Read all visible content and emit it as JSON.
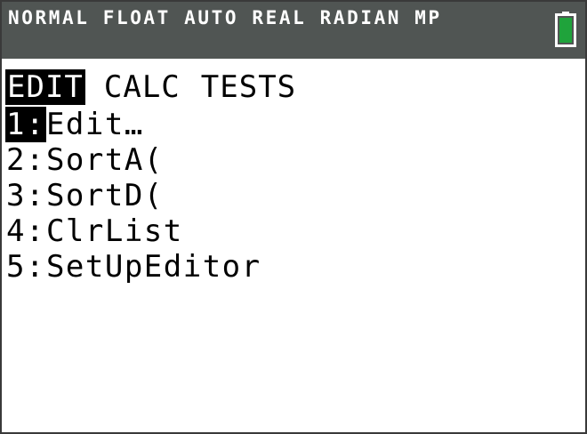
{
  "status_bar": {
    "text": "NORMAL FLOAT AUTO REAL RADIAN MP",
    "battery_icon": "battery-full-icon",
    "battery_color": "#1fa33b"
  },
  "tabs": [
    {
      "label": "EDIT",
      "active": true
    },
    {
      "label": "CALC",
      "active": false
    },
    {
      "label": "TESTS",
      "active": false
    }
  ],
  "menu": {
    "items": [
      {
        "number": "1:",
        "label": "Edit…",
        "selected": true
      },
      {
        "number": "2:",
        "label": "SortA(",
        "selected": false
      },
      {
        "number": "3:",
        "label": "SortD(",
        "selected": false
      },
      {
        "number": "4:",
        "label": "ClrList",
        "selected": false
      },
      {
        "number": "5:",
        "label": "SetUpEditor",
        "selected": false
      }
    ]
  },
  "colors": {
    "status_bar_bg": "#505553",
    "highlight_bg": "#000000",
    "highlight_fg": "#ffffff"
  }
}
